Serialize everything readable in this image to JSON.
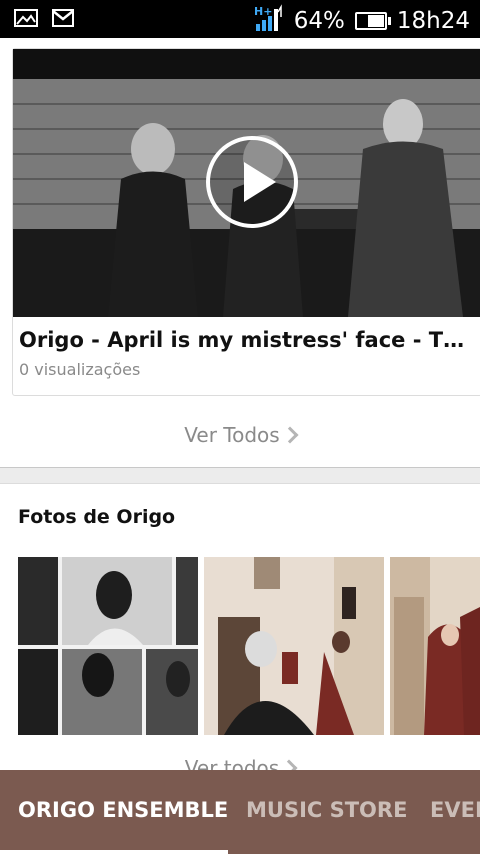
{
  "status_bar": {
    "battery_percent": "64%",
    "time": "18h24",
    "network": "H+",
    "icons": [
      "gallery-icon",
      "gmail-icon",
      "signal-icon",
      "battery-icon"
    ]
  },
  "video": {
    "title": "Origo - April is my mistress' face - Thomas M...",
    "views": "0 visualizações"
  },
  "videos_see_all": "Ver Todos",
  "photos_section": {
    "title": "Fotos de Origo",
    "see_all": "Ver todos"
  },
  "tabs": [
    {
      "label": "ORIGO ENSEMBLE",
      "active": true
    },
    {
      "label": "MUSIC STORE",
      "active": false
    },
    {
      "label": "EVEN",
      "active": false
    }
  ],
  "colors": {
    "tab_bar": "#7b5a50",
    "status_bar": "#000000"
  }
}
